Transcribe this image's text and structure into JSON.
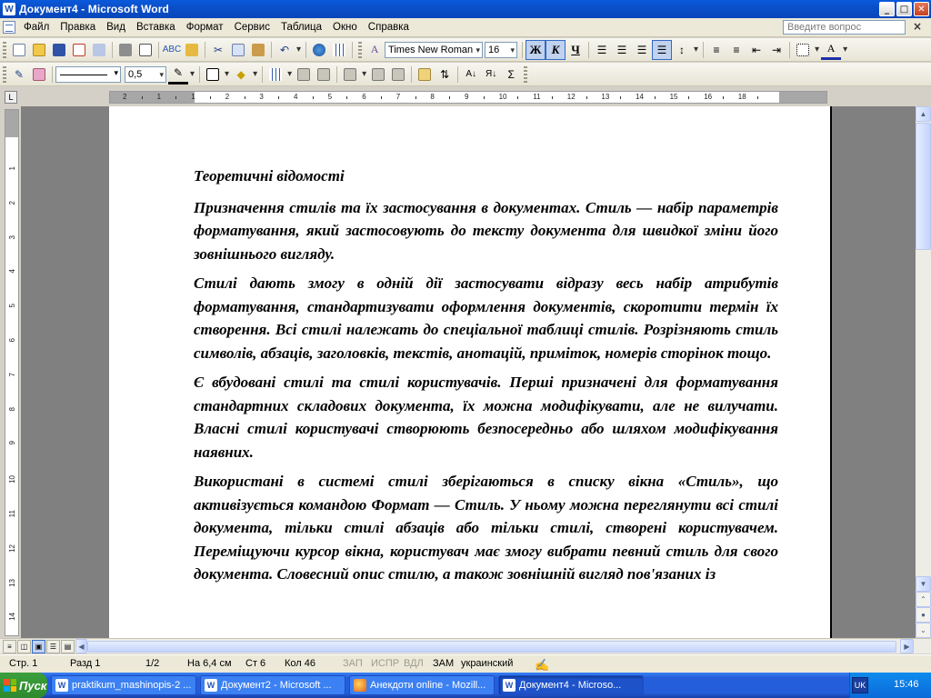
{
  "title": "Документ4 - Microsoft Word",
  "window_buttons": {
    "minimize": "_",
    "maximize": "□",
    "close": "✕"
  },
  "menu": [
    "Файл",
    "Правка",
    "Вид",
    "Вставка",
    "Формат",
    "Сервис",
    "Таблица",
    "Окно",
    "Справка"
  ],
  "help_placeholder": "Введите вопрос",
  "doc_close": "×",
  "formatting": {
    "font": "Times New Roman",
    "size": "16",
    "bold": "Ж",
    "italic": "К",
    "underline": "Ч",
    "line_weight": "0,5"
  },
  "ruler_numbers": [
    "2",
    "1",
    "1",
    "2",
    "3",
    "4",
    "5",
    "6",
    "7",
    "8",
    "9",
    "10",
    "11",
    "12",
    "13",
    "14",
    "15",
    "16",
    "18"
  ],
  "vruler_numbers": [
    "1",
    "2",
    "3",
    "4",
    "5",
    "6",
    "7",
    "8",
    "9",
    "10",
    "11",
    "12",
    "13",
    "14"
  ],
  "document": {
    "heading": "Теоретичні відомості",
    "paragraphs": [
      "Призначення стилів та їх застосування в документах. Стиль — набір параметрів форматування, який застосовують до тексту документа для швидкої зміни його зовнішнього вигляду.",
      "Стилі дають змогу в одній дії застосувати відразу весь набір атрибутів форматування, стандартизувати оформлення документів, скоротити термін їх створення. Всі стилі належать до спеціальної таблиці стилів. Розрізняють стиль символів, абзаців, заголовків, текстів, анотацій, приміток, номерів сторінок тощо.",
      "Є вбудовані стилі та стилі користувачів. Перші призначені для форматування стандартних складових документа, їх можна модифікувати, але не вилучати. Власні стилі користувачі створюють безпосередньо або шляхом модифікування наявних.",
      "Використані в системі стилі зберігаються в списку вікна «Стиль», що активізується командою Формат — Стиль. У ньому можна переглянути всі стилі документа, тільки стилі абзаців або тільки стилі, створені користувачем. Переміщуючи курсор вікна, користувач має змогу вибрати певний стиль для свого документа. Словесний опис стилю, а також зовнішній вигляд пов'язаних із"
    ]
  },
  "status": {
    "page": "Стр. 1",
    "section": "Разд 1",
    "pages": "1/2",
    "at": "На 6,4 см",
    "line": "Ст 6",
    "col": "Кол 46",
    "rec": "ЗАП",
    "trk": "ИСПР",
    "ext": "ВДЛ",
    "ovr": "ЗАМ",
    "lang": "украинский"
  },
  "taskbar": {
    "start": "Пуск",
    "tasks": [
      {
        "label": "praktikum_mashinopis-2 ...",
        "icon": "W"
      },
      {
        "label": "Документ2 - Microsoft ...",
        "icon": "W"
      },
      {
        "label": "Анекдоти online - Mozill...",
        "icon": "ff"
      },
      {
        "label": "Документ4 - Microso...",
        "icon": "W",
        "active": true
      }
    ],
    "lang": "UK",
    "clock": "15:46",
    "tray_arrow": "«"
  }
}
